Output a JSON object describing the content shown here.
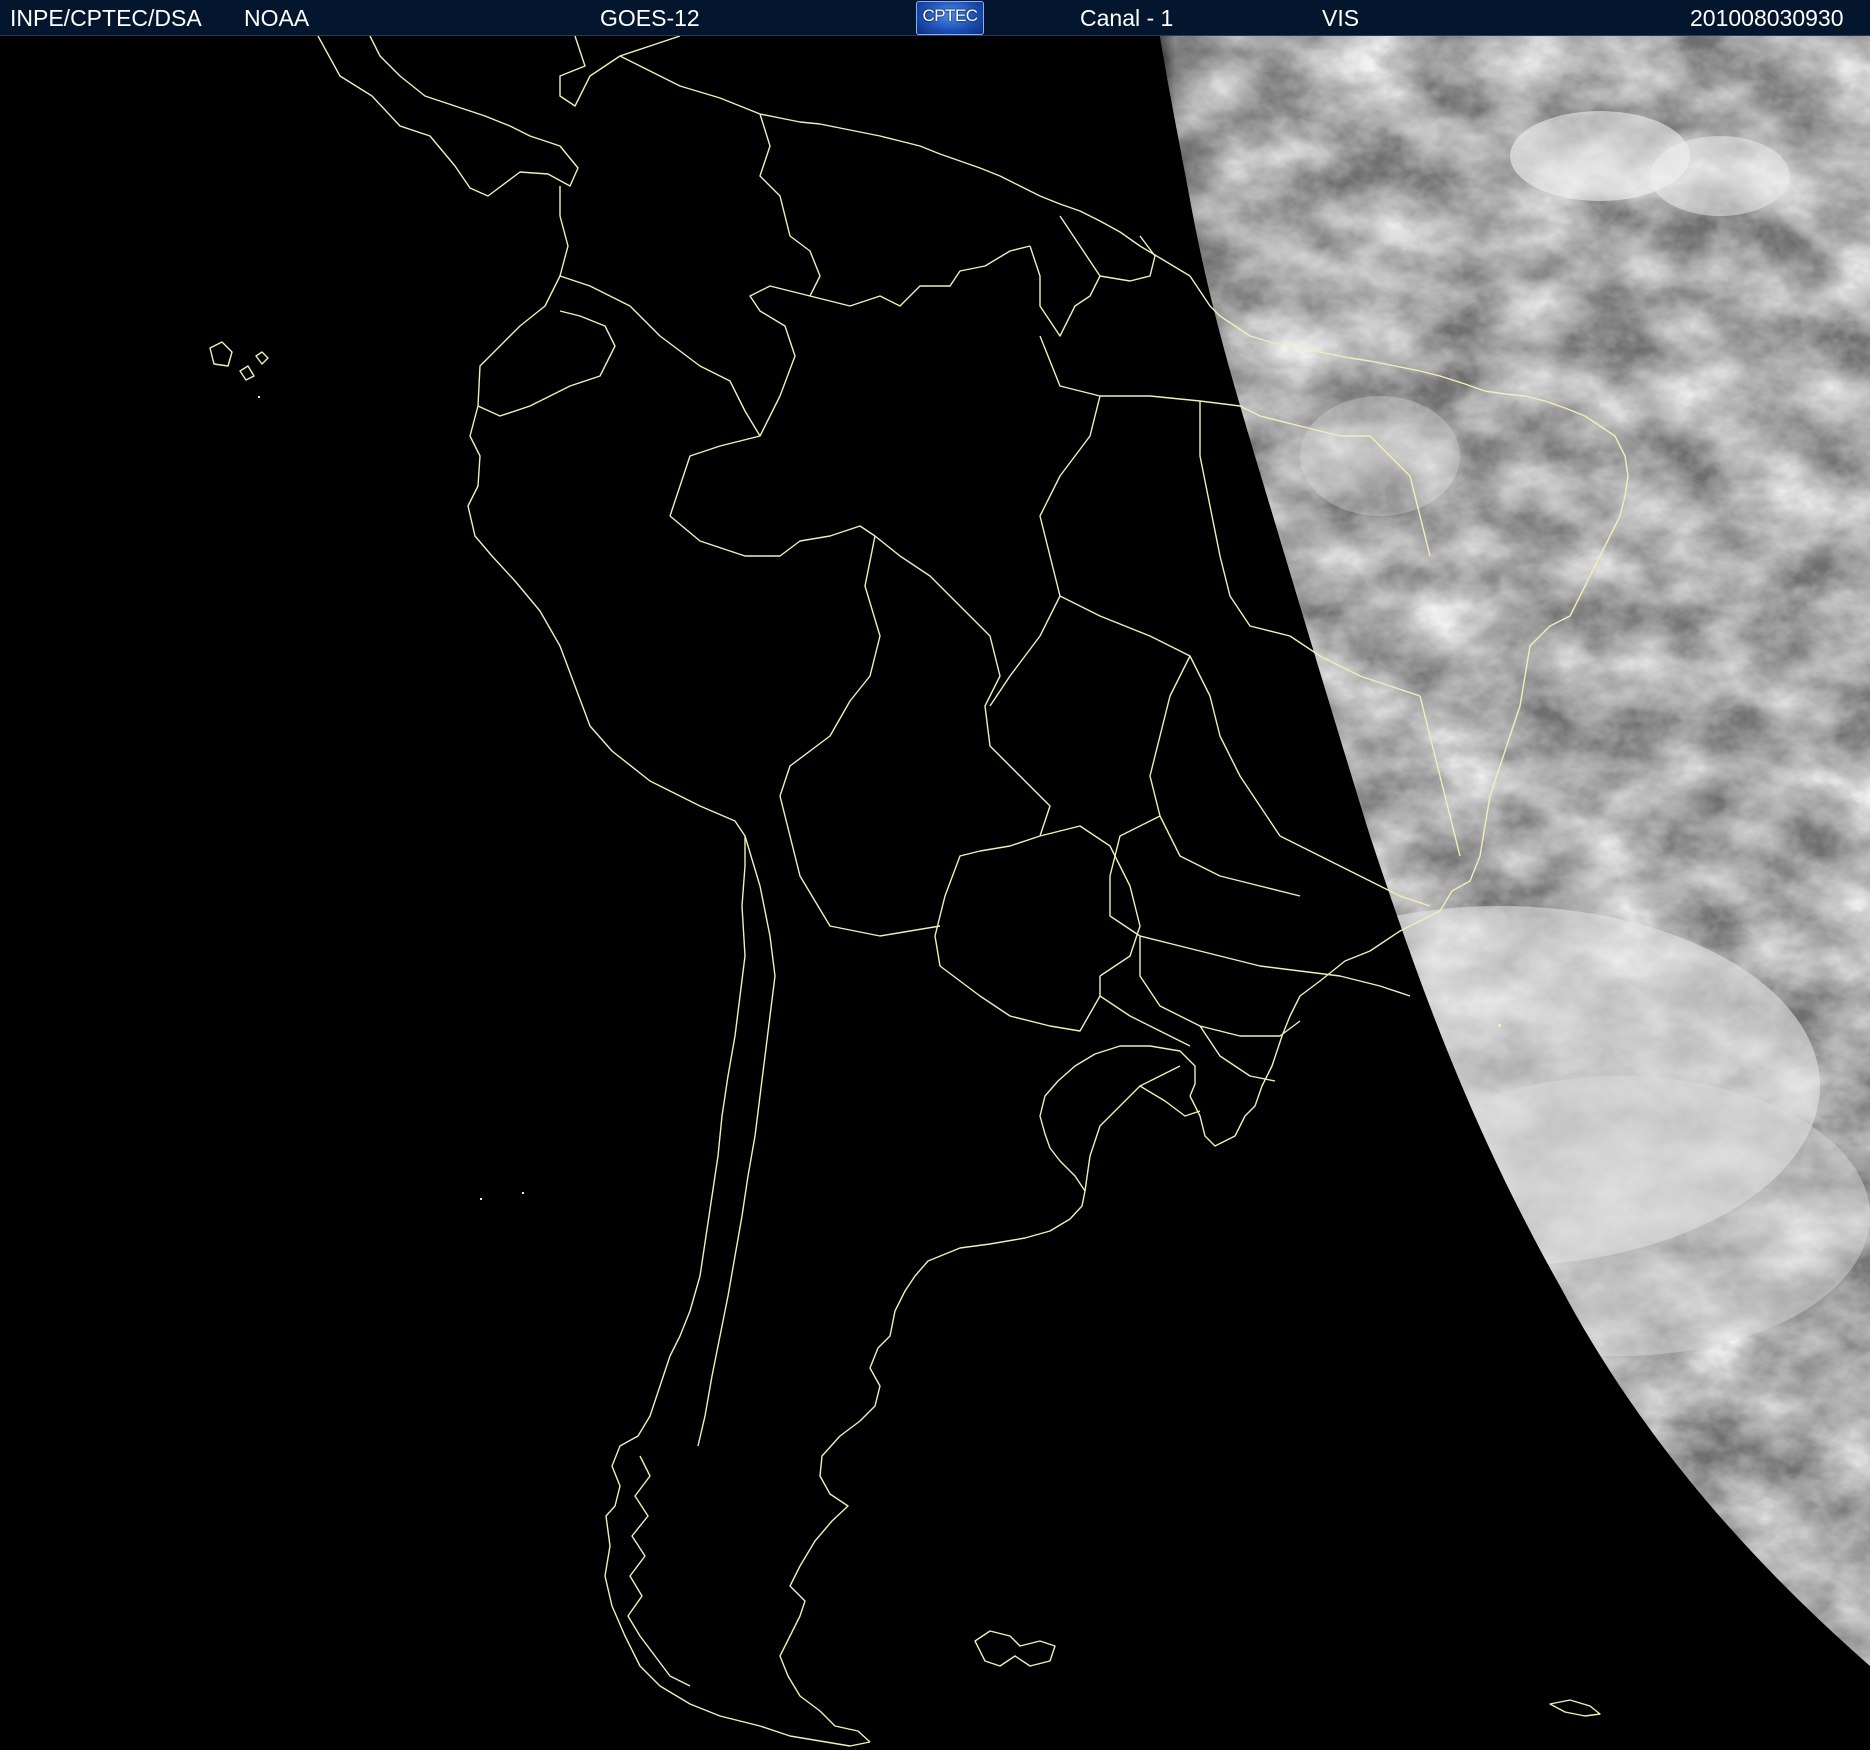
{
  "header": {
    "institution": "INPE/CPTEC/DSA",
    "agency": "NOAA",
    "satellite": "GOES-12",
    "logo_text": "CPTEC",
    "channel": "Canal - 1",
    "band": "VIS",
    "timestamp": "201008030930"
  },
  "colors": {
    "header_background": "#04162e",
    "header_text": "#ffffff",
    "map_background": "#000000",
    "boundary_lines": "#f0efb8",
    "cloud_imagery": "#9a9a9a"
  }
}
